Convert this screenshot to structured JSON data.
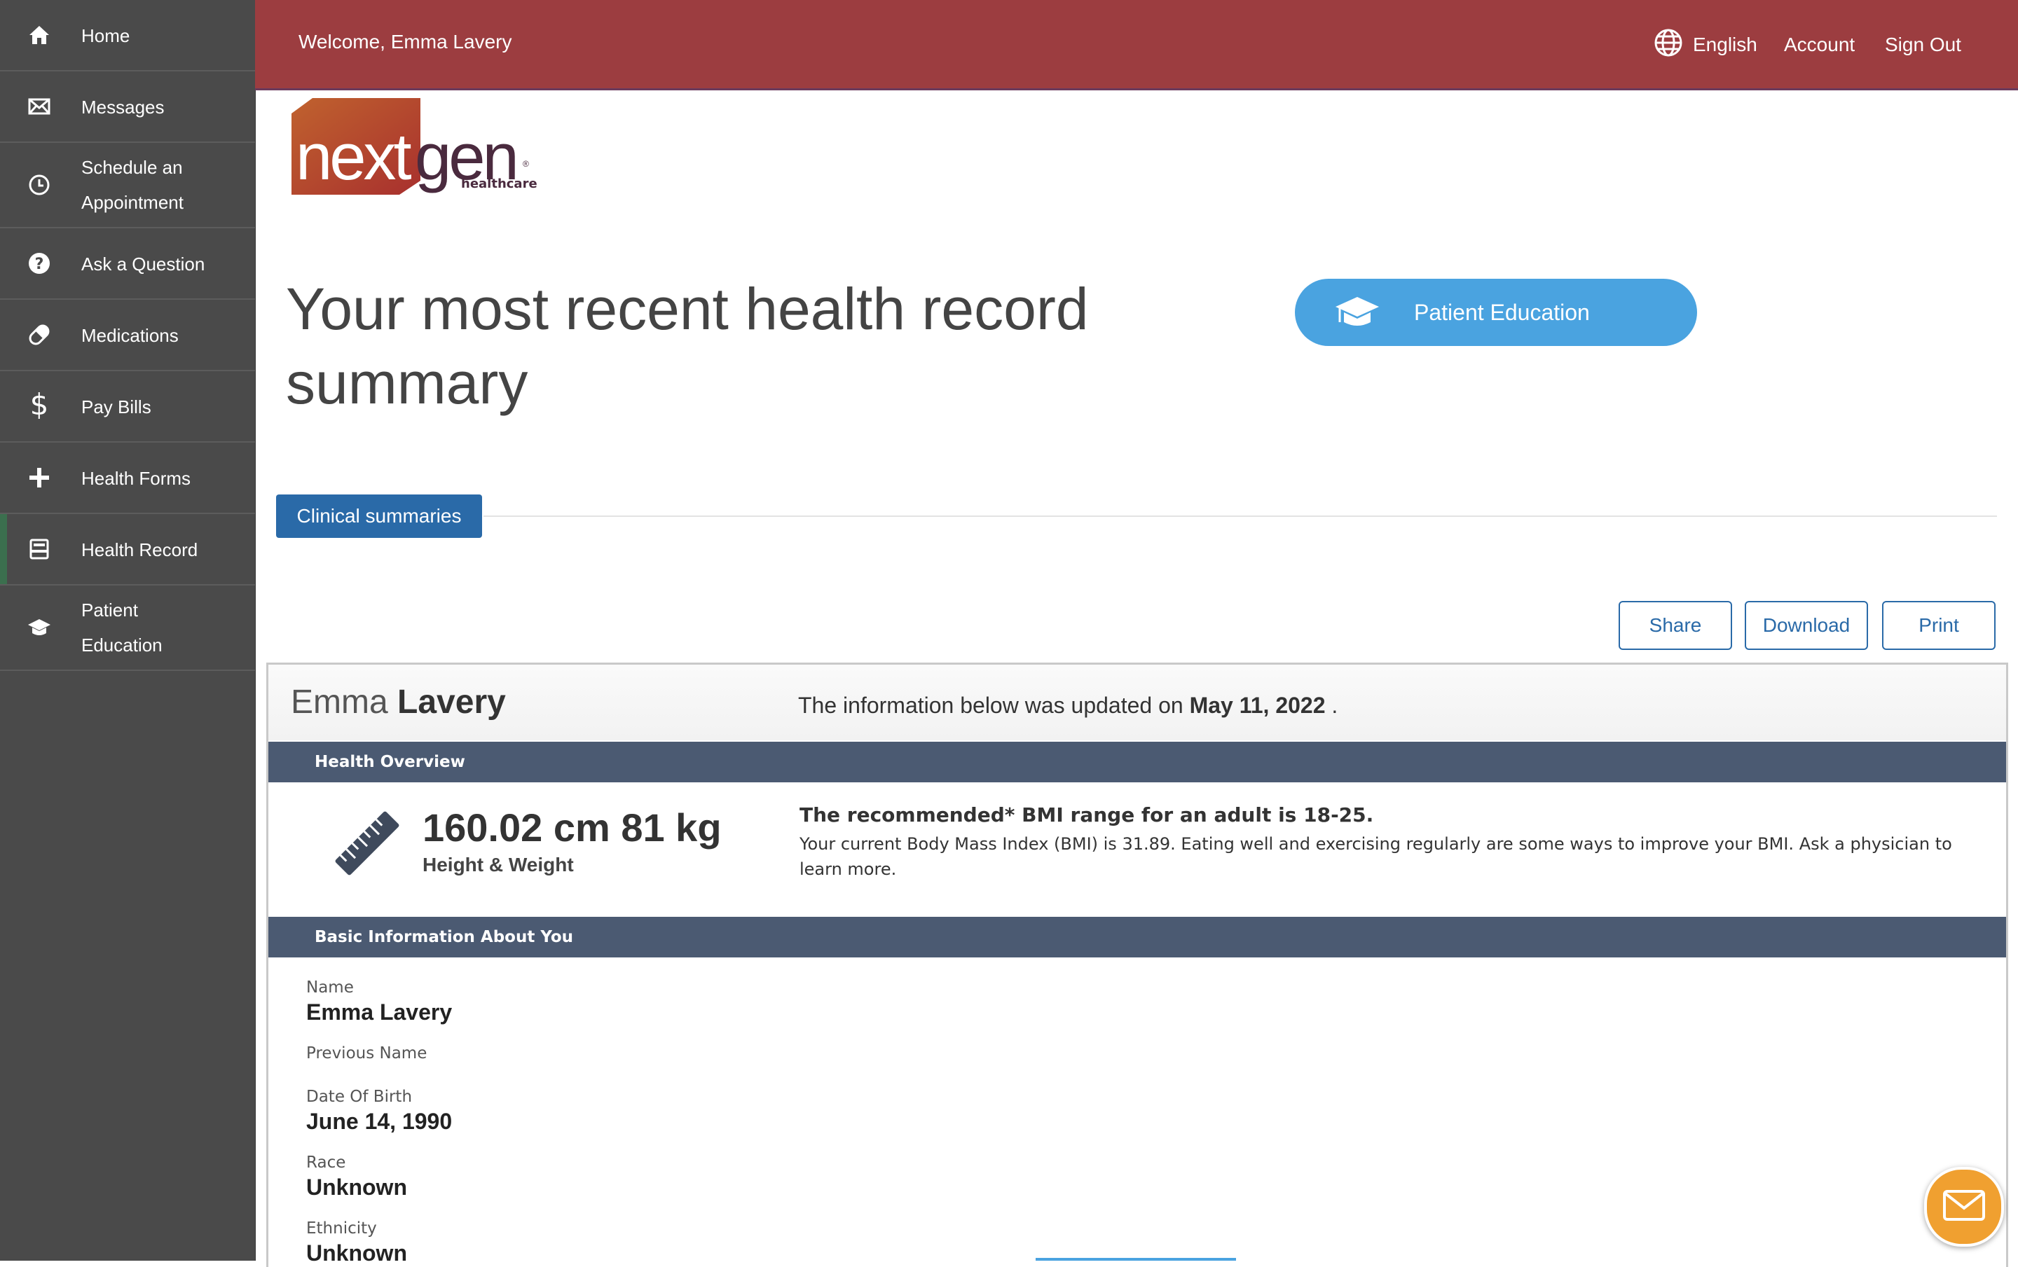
{
  "sidebar": {
    "items": [
      {
        "label": "Home",
        "icon": "home-icon"
      },
      {
        "label": "Messages",
        "icon": "envelope-icon"
      },
      {
        "label": "Schedule an\nAppointment",
        "icon": "clock-icon"
      },
      {
        "label": "Ask a Question",
        "icon": "question-icon"
      },
      {
        "label": "Medications",
        "icon": "pill-icon"
      },
      {
        "label": "Pay Bills",
        "icon": "dollar-icon"
      },
      {
        "label": "Health Forms",
        "icon": "plus-icon"
      },
      {
        "label": "Health Record",
        "icon": "record-icon"
      },
      {
        "label": "Patient\nEducation",
        "icon": "graduation-cap-icon"
      }
    ],
    "active_item": "Health Record"
  },
  "header": {
    "welcome": "Welcome, Emma Lavery",
    "language": "English",
    "account": "Account",
    "sign_out": "Sign Out"
  },
  "logo": {
    "brand": "nextgen",
    "sub": "healthcare",
    "reg": "®"
  },
  "main": {
    "title": "Your most recent health record summary",
    "patient_education_button": "Patient Education",
    "tab_clinical": "Clinical summaries",
    "share": "Share",
    "download": "Download",
    "print": "Print"
  },
  "record": {
    "first_name": "Emma",
    "last_name": "Lavery",
    "updated_prefix": "The information below was updated on",
    "updated_date": "May 11, 2022",
    "updated_suffix": ".",
    "health_overview_title": "Health Overview",
    "height_weight": "160.02 cm 81 kg",
    "height_weight_label": "Height & Weight",
    "bmi_heading": "The recommended* BMI range for an adult is 18-25.",
    "bmi_text": "Your current Body Mass Index (BMI) is 31.89. Eating well and exercising regularly are some ways to improve your BMI. Ask a physician to learn more.",
    "basic_info_title": "Basic Information About You",
    "fields": [
      {
        "label": "Name",
        "value": "Emma Lavery"
      },
      {
        "label": "Previous Name",
        "value": ""
      },
      {
        "label": "Date Of Birth",
        "value": "June 14, 1990"
      },
      {
        "label": "Race",
        "value": "Unknown"
      },
      {
        "label": "Ethnicity",
        "value": "Unknown"
      }
    ]
  },
  "colors": {
    "sidebar_bg": "#4a4a4a",
    "header_bg": "#9c3d40",
    "accent_blue": "#2a6aa8",
    "edu_button": "#4aa3e0",
    "section_bar": "#4b5a72",
    "chat_button": "#f0a030"
  }
}
